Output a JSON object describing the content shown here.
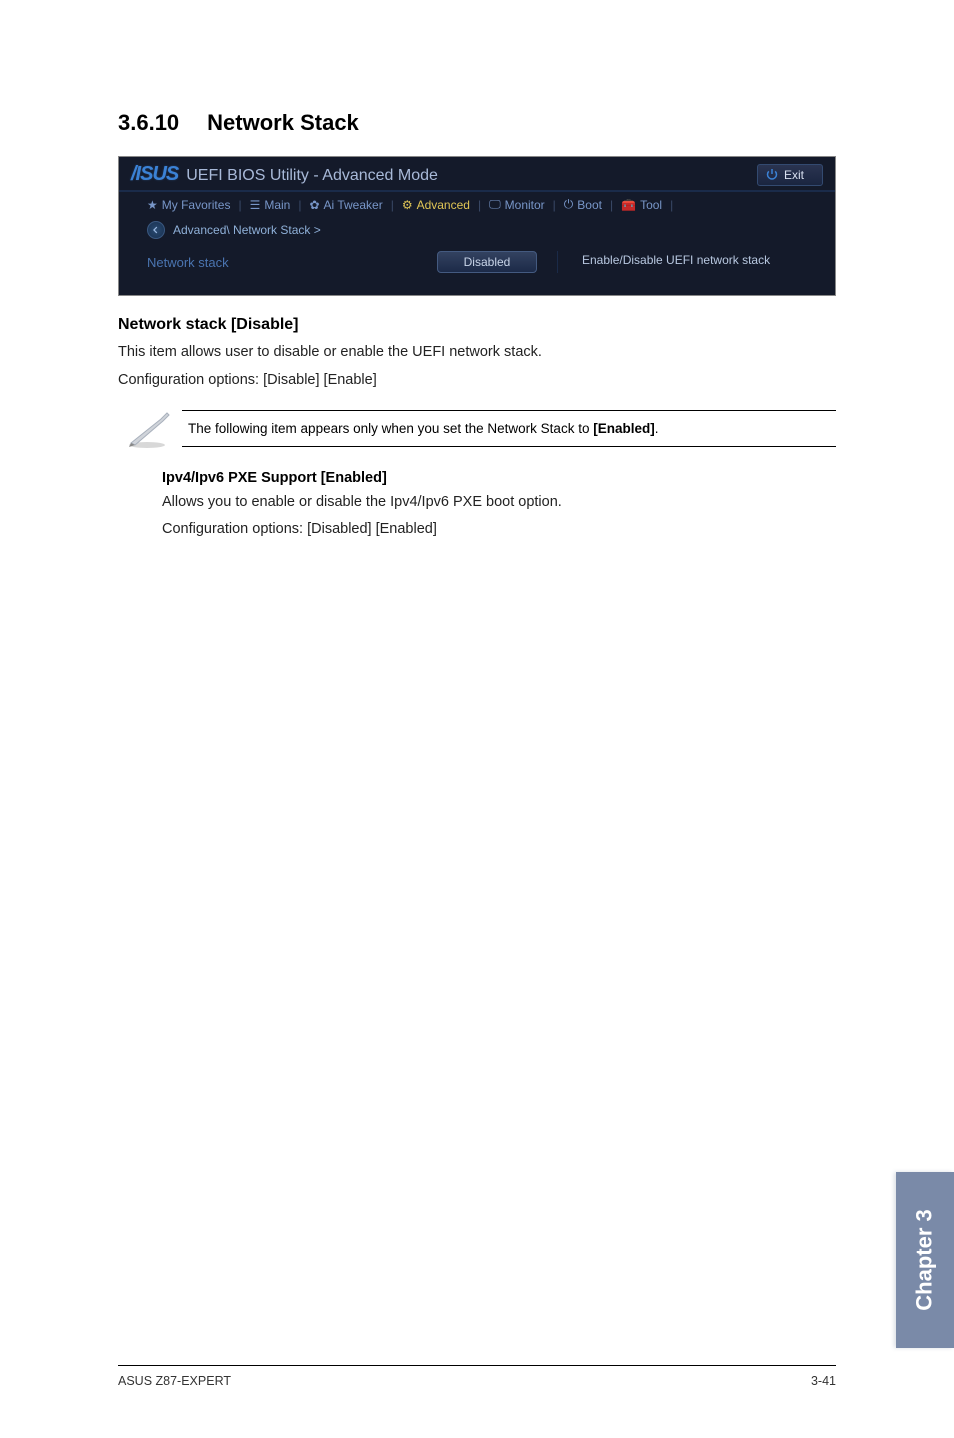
{
  "section": {
    "number": "3.6.10",
    "title": "Network Stack"
  },
  "bios": {
    "logo": "/ISUS",
    "utility_text": "UEFI BIOS Utility - Advanced Mode",
    "exit_label": "Exit",
    "tabs": {
      "favorites": "My Favorites",
      "main": "Main",
      "tweaker": "Ai Tweaker",
      "advanced": "Advanced",
      "monitor": "Monitor",
      "boot": "Boot",
      "tool": "Tool"
    },
    "breadcrumb": "Advanced\\ Network Stack >",
    "item_label": "Network stack",
    "item_value": "Disabled",
    "help_text": "Enable/Disable UEFI network stack"
  },
  "setting": {
    "heading": "Network stack [Disable]",
    "description": "This item allows user to disable or enable the UEFI network stack.",
    "config_options": "Configuration options: [Disable] [Enable]"
  },
  "note": {
    "text_prefix": "The following item appears only when you set the Network Stack to ",
    "text_bold": "[Enabled]",
    "text_suffix": "."
  },
  "sub_setting": {
    "heading": "Ipv4/Ipv6 PXE Support [Enabled]",
    "description": "Allows you to enable or disable the Ipv4/Ipv6 PXE boot option.",
    "config_options": "Configuration options: [Disabled] [Enabled]"
  },
  "chapter_label": "Chapter 3",
  "footer": {
    "left": "ASUS Z87-EXPERT",
    "right": "3-41"
  }
}
